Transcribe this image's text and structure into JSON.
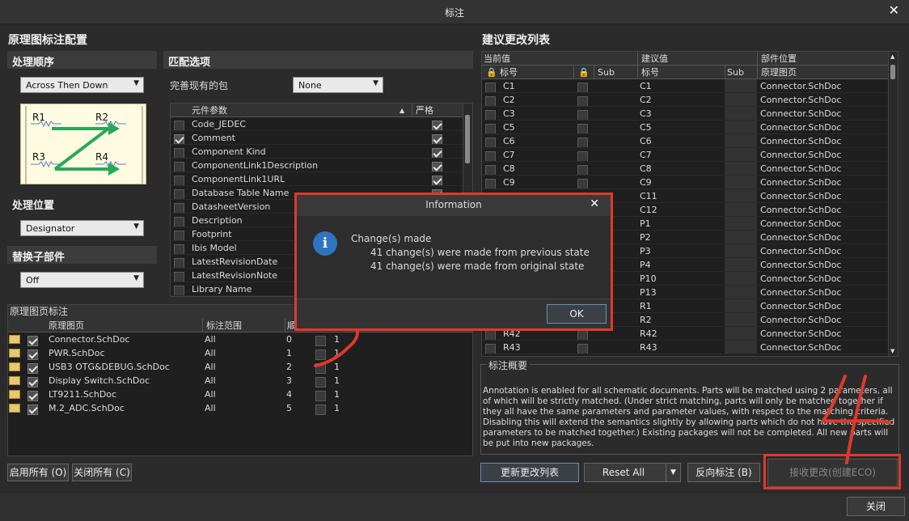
{
  "window": {
    "title": "标注",
    "close_label": "关闭"
  },
  "left": {
    "heading": "原理图标注配置",
    "order_section": "处理顺序",
    "order_value": "Across Then Down",
    "match_section": "匹配选项",
    "packages_label": "完善现有的包",
    "packages_value": "None",
    "params_header": "元件参数",
    "strict_header": "严格",
    "params": [
      {
        "name": "Code_JEDEC",
        "checked": false,
        "strict": true
      },
      {
        "name": "Comment",
        "checked": true,
        "strict": true
      },
      {
        "name": "Component Kind",
        "checked": false,
        "strict": true
      },
      {
        "name": "ComponentLink1Description",
        "checked": false,
        "strict": true
      },
      {
        "name": "ComponentLink1URL",
        "checked": false,
        "strict": true
      },
      {
        "name": "Database Table Name",
        "checked": false,
        "strict": true
      },
      {
        "name": "DatasheetVersion",
        "checked": false,
        "strict": true
      },
      {
        "name": "Description",
        "checked": false,
        "strict": true
      },
      {
        "name": "Footprint",
        "checked": false,
        "strict": true
      },
      {
        "name": "Ibis Model",
        "checked": false,
        "strict": true
      },
      {
        "name": "LatestRevisionDate",
        "checked": false,
        "strict": true
      },
      {
        "name": "LatestRevisionNote",
        "checked": false,
        "strict": true
      },
      {
        "name": "Library Name",
        "checked": false,
        "strict": true
      }
    ],
    "location_section": "处理位置",
    "location_value": "Designator",
    "replace_section": "替换子部件",
    "replace_value": "Off",
    "diagram": {
      "r1": "R1",
      "r2": "R2",
      "r3": "R3",
      "r4": "R4"
    },
    "sheets_section": "原理图页标注",
    "sheets_headers": {
      "sheet": "原理图页",
      "scope": "标注范围",
      "order": "顺",
      "start": "",
      "index": ""
    },
    "sheets": [
      {
        "name": "Connector.SchDoc",
        "scope": "All",
        "order": "0",
        "start": "1"
      },
      {
        "name": "PWR.SchDoc",
        "scope": "All",
        "order": "1",
        "start": "1"
      },
      {
        "name": "USB3 OTG&DEBUG.SchDoc",
        "scope": "All",
        "order": "2",
        "start": "1"
      },
      {
        "name": "Display Switch.SchDoc",
        "scope": "All",
        "order": "3",
        "start": "1"
      },
      {
        "name": "LT9211.SchDoc",
        "scope": "All",
        "order": "4",
        "start": "1"
      },
      {
        "name": "M.2_ADC.SchDoc",
        "scope": "All",
        "order": "5",
        "start": "1"
      }
    ],
    "enable_all": "启用所有 (O)",
    "disable_all": "关闭所有 (C)"
  },
  "right": {
    "heading": "建议更改列表",
    "col_current": "当前值",
    "col_proposed": "建议值",
    "col_location": "部件位置",
    "sub_designator": "标号",
    "sub_sub": "Sub",
    "sub_sheet": "原理图页",
    "rows": [
      {
        "cur": "C1",
        "prop": "C1",
        "loc": "Connector.SchDoc"
      },
      {
        "cur": "C2",
        "prop": "C2",
        "loc": "Connector.SchDoc"
      },
      {
        "cur": "C3",
        "prop": "C3",
        "loc": "Connector.SchDoc"
      },
      {
        "cur": "C5",
        "prop": "C5",
        "loc": "Connector.SchDoc"
      },
      {
        "cur": "C6",
        "prop": "C6",
        "loc": "Connector.SchDoc"
      },
      {
        "cur": "C7",
        "prop": "C7",
        "loc": "Connector.SchDoc"
      },
      {
        "cur": "C8",
        "prop": "C8",
        "loc": "Connector.SchDoc"
      },
      {
        "cur": "C9",
        "prop": "C9",
        "loc": "Connector.SchDoc"
      },
      {
        "cur": "",
        "prop": "C11",
        "loc": "Connector.SchDoc"
      },
      {
        "cur": "",
        "prop": "C12",
        "loc": "Connector.SchDoc"
      },
      {
        "cur": "",
        "prop": "P1",
        "loc": "Connector.SchDoc"
      },
      {
        "cur": "",
        "prop": "P2",
        "loc": "Connector.SchDoc"
      },
      {
        "cur": "",
        "prop": "P3",
        "loc": "Connector.SchDoc"
      },
      {
        "cur": "",
        "prop": "P4",
        "loc": "Connector.SchDoc"
      },
      {
        "cur": "",
        "prop": "P10",
        "loc": "Connector.SchDoc"
      },
      {
        "cur": "",
        "prop": "P13",
        "loc": "Connector.SchDoc"
      },
      {
        "cur": "",
        "prop": "R1",
        "loc": "Connector.SchDoc"
      },
      {
        "cur": "",
        "prop": "R2",
        "loc": "Connector.SchDoc"
      },
      {
        "cur": "R42",
        "prop": "R42",
        "loc": "Connector.SchDoc"
      },
      {
        "cur": "R43",
        "prop": "R43",
        "loc": "Connector.SchDoc"
      }
    ],
    "summary_title": "标注概要",
    "summary_text": "Annotation is enabled for all schematic documents. Parts will be matched using 2 parameters, all of which will be strictly matched. (Under strict matching, parts will only be matched together if they all have the same parameters and parameter values, with respect to the matching criteria. Disabling this will extend the semantics slightly by allowing parts which do not have the specified parameters to be matched together.) Existing packages will not be completed. All new parts will be put into new packages.",
    "update_btn": "更新更改列表",
    "reset_btn": "Reset All",
    "back_btn": "反向标注 (B)",
    "accept_btn": "接收更改(创建ECO)"
  },
  "dialog": {
    "title": "Information",
    "line1": "Change(s) made",
    "line2": "41 change(s) were made from previous state",
    "line3": "41 change(s) were made from original state",
    "ok": "OK"
  },
  "colors": {
    "annotation_red": "#e0392b",
    "info_blue": "#2f74c0"
  }
}
